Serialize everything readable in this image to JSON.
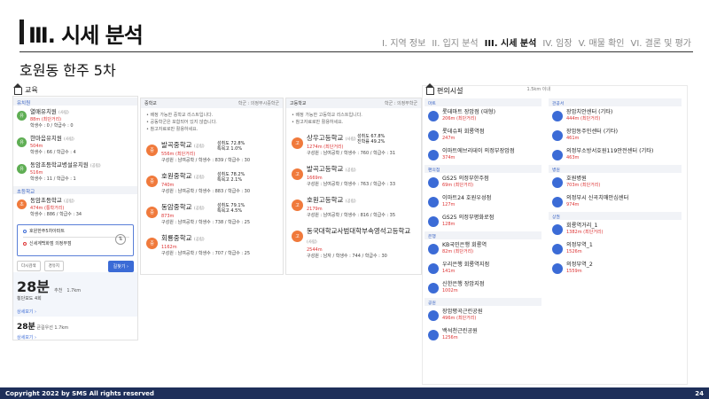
{
  "header": {
    "title": "Ⅲ. 시세 분석",
    "subtitle": "호원동 한주 5차"
  },
  "nav": [
    "I. 지역 정보",
    "II. 입지 분석",
    "III. 시세 분석",
    "IV. 임장",
    "V. 매물 확인",
    "VI. 결론 및 평가"
  ],
  "edu": {
    "title": "교육",
    "kinder_header": "유치원",
    "kinder": [
      {
        "name": "열매유치원",
        "type": "(사립)",
        "dist": "88m (최단거리)",
        "info": "학생수 : 0 / 학급수 : 0"
      },
      {
        "name": "한마음유치원",
        "type": "(사립)",
        "dist": "504m",
        "info": "학생수 : 66 / 학급수 : 4"
      },
      {
        "name": "동암초등학교병설유치원",
        "type": "(공립)",
        "dist": "516m",
        "info": "학생수 : 11 / 학급수 : 1"
      }
    ],
    "elem_header": "초등학교",
    "elem": [
      {
        "name": "동암초등학교",
        "type": "(공립)",
        "dist": "474m (통학거리)",
        "info": "학생수 : 886 / 학급수 : 34"
      }
    ],
    "search_from": "호원한주5차아파트",
    "search_to": "신세계백화점 의정부점",
    "btn_back": "다시검색",
    "btn_via": "경유지",
    "btn_go": "길찾기 ›",
    "route1_time": "28분",
    "route1_mode": "추천",
    "route1_dist": "1.7km",
    "route1_detail": "횡단보도 4회",
    "route1_more": "상세보기 ›",
    "route2_time": "28분",
    "route2_mode": "큰길우선",
    "route2_dist": "1.7km",
    "route2_more": "상세보기 ›"
  },
  "middle": {
    "title": "중학교",
    "right": "학군 : 의정부시중학군",
    "notes": [
      "• 배정 가능한 중학교 리스트입니다.",
      "• 공동학군은 포함되어 있지 않습니다.",
      "• 참고자료로만 활용하세요."
    ],
    "schools": [
      {
        "name": "발곡중학교",
        "type": "(공립)",
        "dist": "556m (최단거리)",
        "info": "구성원 : 남여공학 / 학생수 : 839 / 학급수 : 30",
        "r1": "성취도 72.8%",
        "r2": "특목고 1.0%"
      },
      {
        "name": "호원중학교",
        "type": "(공립)",
        "dist": "740m",
        "info": "구성원 : 남여공학 / 학생수 : 883 / 학급수 : 30",
        "r1": "성취도 78.2%",
        "r2": "특목고 2.1%"
      },
      {
        "name": "동암중학교",
        "type": "(공립)",
        "dist": "873m",
        "info": "구성원 : 남여공학 / 학생수 : 738 / 학급수 : 25",
        "r1": "성취도 79.1%",
        "r2": "특목고 4.5%"
      },
      {
        "name": "회룡중학교",
        "type": "(공립)",
        "dist": "1162m",
        "info": "구성원 : 남여공학 / 학생수 : 707 / 학급수 : 25",
        "r1": "",
        "r2": ""
      }
    ]
  },
  "high": {
    "title": "고등학교",
    "right": "학군 : 의정부학군",
    "notes": [
      "• 배정 가능한 고등학교 리스트입니다.",
      "• 참고자료로만 활용하세요."
    ],
    "schools": [
      {
        "name": "상우고등학교",
        "type": "(사립)",
        "dist": "1274m (최단거리)",
        "info": "구성원 : 남여공학 / 학생수 : 760 / 학급수 : 31",
        "r1": "성취도 67.8%",
        "r2": "진학률 49.2%"
      },
      {
        "name": "발곡고등학교",
        "type": "(공립)",
        "dist": "1669m",
        "info": "구성원 : 남여공학 / 학생수 : 763 / 학급수 : 33",
        "r1": "",
        "r2": ""
      },
      {
        "name": "호원고등학교",
        "type": "(공립)",
        "dist": "2179m",
        "info": "구성원 : 남여공학 / 학생수 : 816 / 학급수 : 35",
        "r1": "",
        "r2": ""
      },
      {
        "name": "동국대학교사범대학부속영석고등학교",
        "type": "(사립)",
        "dist": "2544m",
        "info": "구성원 : 남자 / 학생수 : 744 / 학급수 : 30",
        "r1": "",
        "r2": ""
      }
    ]
  },
  "amenity": {
    "title": "편의시설",
    "range": "1.5km 이내",
    "col1": [
      {
        "cat": "마트",
        "items": [
          {
            "name": "롯데마트 장암점 (대형)",
            "dist": "206m (최단거리)"
          },
          {
            "name": "롯데슈퍼 회룡역점",
            "dist": "247m"
          },
          {
            "name": "이마트에브리데이 의정부장암점",
            "dist": "374m"
          }
        ]
      },
      {
        "cat": "편의점",
        "items": [
          {
            "name": "GS25 의정부한주점",
            "dist": "69m (최단거리)"
          },
          {
            "name": "이마트24 호원우성점",
            "dist": "127m"
          },
          {
            "name": "GS25 의정부평화로점",
            "dist": "128m"
          }
        ]
      },
      {
        "cat": "은행",
        "items": [
          {
            "name": "KB국민은행 회룡역",
            "dist": "82m (최단거리)"
          },
          {
            "name": "우리은행 회룡역지점",
            "dist": "141m"
          },
          {
            "name": "신한은행 장암지점",
            "dist": "1002m"
          }
        ]
      },
      {
        "cat": "공원",
        "items": [
          {
            "name": "장암평곡근린공원",
            "dist": "496m (최단거리)"
          },
          {
            "name": "백석천근린공원",
            "dist": "1256m"
          }
        ]
      }
    ],
    "col2": [
      {
        "cat": "관공서",
        "items": [
          {
            "name": "장암치안센터 (기타)",
            "dist": "444m (최단거리)"
          },
          {
            "name": "장암동주민센터 (기타)",
            "dist": "461m"
          },
          {
            "name": "의정부소방서호원119안전센터 (기타)",
            "dist": "463m"
          }
        ]
      },
      {
        "cat": "병원",
        "items": [
          {
            "name": "호원병원",
            "dist": "703m (최단거리)"
          },
          {
            "name": "의정부시 신곡치매안심센터",
            "dist": "974m"
          }
        ]
      },
      {
        "cat": "상권",
        "items": [
          {
            "name": "회룡역거리_1",
            "dist": "1382m (최단거리)"
          },
          {
            "name": "의정부역_1",
            "dist": "1526m"
          },
          {
            "name": "의정부역_2",
            "dist": "1559m"
          }
        ]
      }
    ]
  },
  "footer": {
    "copyright": "Copyright 2022 by SMS All rights reserved",
    "page": "24"
  }
}
